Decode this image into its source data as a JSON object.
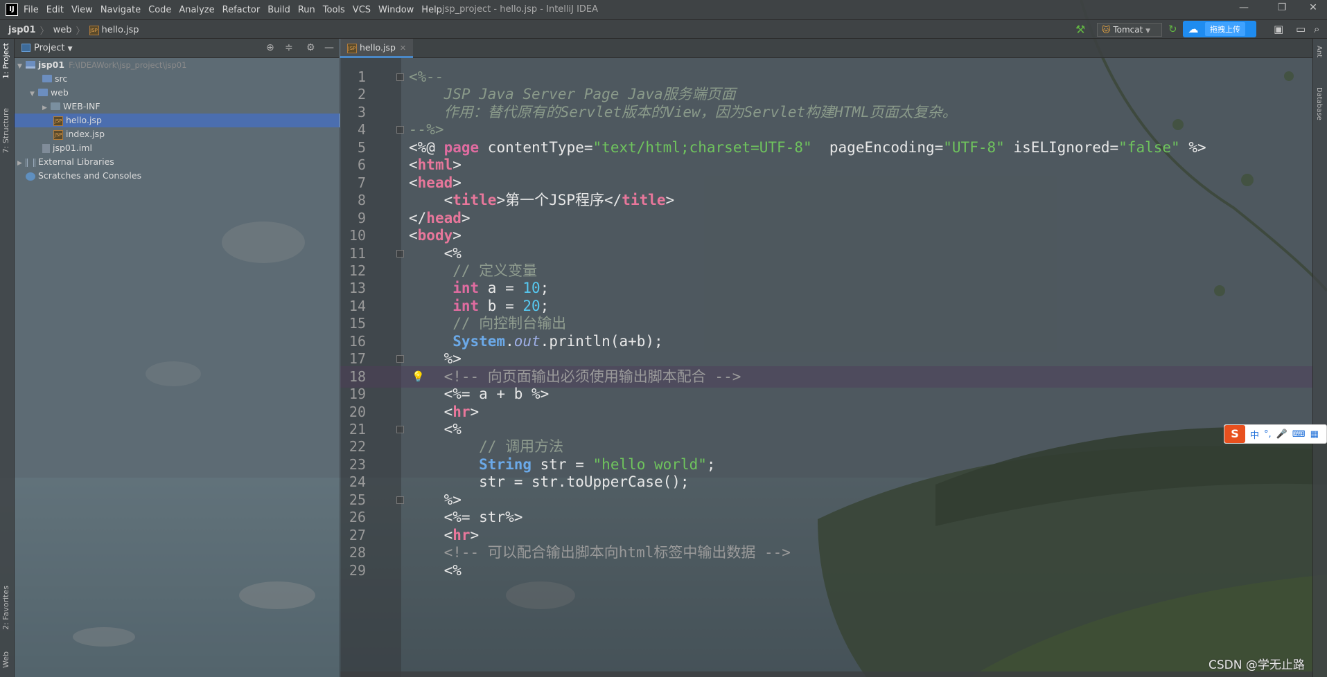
{
  "window": {
    "title": "jsp_project - hello.jsp - IntelliJ IDEA",
    "app_icon": "IJ"
  },
  "menu": [
    "File",
    "Edit",
    "View",
    "Navigate",
    "Code",
    "Analyze",
    "Refactor",
    "Build",
    "Run",
    "Tools",
    "VCS",
    "Window",
    "Help"
  ],
  "breadcrumb": {
    "root": "jsp01",
    "folder": "web",
    "file": "hello.jsp"
  },
  "toolbar": {
    "run_config": "Tomcat",
    "upload_label": "拖拽上传"
  },
  "left_strip": {
    "project_tab": "1: Project",
    "structure_tab": "7: Structure",
    "favorites_tab": "2: Favorites",
    "web_tab": "Web"
  },
  "right_strip": {
    "ant_tab": "Ant",
    "database_tab": "Database"
  },
  "project_panel": {
    "title": "Project",
    "tree": [
      {
        "label": "jsp01",
        "path": "F:\\IDEAWork\\jsp_project\\jsp01"
      },
      {
        "label": "src"
      },
      {
        "label": "web"
      },
      {
        "label": "WEB-INF"
      },
      {
        "label": "hello.jsp"
      },
      {
        "label": "index.jsp"
      },
      {
        "label": "jsp01.iml"
      },
      {
        "label": "External Libraries"
      },
      {
        "label": "Scratches and Consoles"
      }
    ]
  },
  "editor": {
    "tab_label": "hello.jsp",
    "current_line": 18,
    "lines": [
      {
        "n": "1",
        "seg": [
          [
            "cmt",
            "<%--"
          ]
        ]
      },
      {
        "n": "2",
        "seg": [
          [
            "cmt",
            "    JSP Java Server Page Java服务端页面"
          ]
        ]
      },
      {
        "n": "3",
        "seg": [
          [
            "cmt",
            "    作用：替代原有的Servlet版本的View，因为Servlet构建HTML页面太复杂。"
          ]
        ]
      },
      {
        "n": "4",
        "seg": [
          [
            "cmt",
            "--%>"
          ]
        ]
      },
      {
        "n": "5",
        "seg": [
          [
            "dir",
            "<%@ "
          ],
          [
            "kw",
            "page"
          ],
          [
            "attr",
            " contentType="
          ],
          [
            "str",
            "\"text/html;charset=UTF-8\""
          ],
          [
            "attr",
            "  pageEncoding="
          ],
          [
            "str",
            "\"UTF-8\""
          ],
          [
            "attr",
            " isELIgnored="
          ],
          [
            "str",
            "\"false\""
          ],
          [
            "dir",
            " %>"
          ]
        ]
      },
      {
        "n": "6",
        "seg": [
          [
            "tag",
            "<"
          ],
          [
            "name",
            "html"
          ],
          [
            "tag",
            ">"
          ]
        ]
      },
      {
        "n": "7",
        "seg": [
          [
            "tag",
            "<"
          ],
          [
            "name",
            "head"
          ],
          [
            "tag",
            ">"
          ]
        ]
      },
      {
        "n": "8",
        "seg": [
          [
            "tag",
            "    <"
          ],
          [
            "name",
            "title"
          ],
          [
            "tag",
            ">第一个JSP程序</"
          ],
          [
            "name",
            "title"
          ],
          [
            "tag",
            ">"
          ]
        ]
      },
      {
        "n": "9",
        "seg": [
          [
            "tag",
            "</"
          ],
          [
            "name",
            "head"
          ],
          [
            "tag",
            ">"
          ]
        ]
      },
      {
        "n": "10",
        "seg": [
          [
            "tag",
            "<"
          ],
          [
            "name",
            "body"
          ],
          [
            "tag",
            ">"
          ]
        ]
      },
      {
        "n": "11",
        "seg": [
          [
            "dir",
            "    <%"
          ]
        ]
      },
      {
        "n": "12",
        "seg": [
          [
            "lcmt",
            "     // 定义变量"
          ]
        ]
      },
      {
        "n": "13",
        "seg": [
          [
            "tag",
            "     "
          ],
          [
            "kw",
            "int"
          ],
          [
            "tag",
            " a = "
          ],
          [
            "num",
            "10"
          ],
          [
            "tag",
            ";"
          ]
        ]
      },
      {
        "n": "14",
        "seg": [
          [
            "tag",
            "     "
          ],
          [
            "kw",
            "int"
          ],
          [
            "tag",
            " b = "
          ],
          [
            "num",
            "20"
          ],
          [
            "tag",
            ";"
          ]
        ]
      },
      {
        "n": "15",
        "seg": [
          [
            "lcmt",
            "     // 向控制台输出"
          ]
        ]
      },
      {
        "n": "16",
        "seg": [
          [
            "tag",
            "     "
          ],
          [
            "cls",
            "System"
          ],
          [
            "tag",
            "."
          ],
          [
            "fld",
            "out"
          ],
          [
            "tag",
            ".println(a+b);"
          ]
        ]
      },
      {
        "n": "17",
        "seg": [
          [
            "dir",
            "    %>"
          ]
        ]
      },
      {
        "n": "18",
        "seg": [
          [
            "hcmt",
            "    <!-- 向页面输出必须使用输出脚本配合 -->"
          ]
        ]
      },
      {
        "n": "19",
        "seg": [
          [
            "dir",
            "    <%= a + b %>"
          ]
        ]
      },
      {
        "n": "20",
        "seg": [
          [
            "tag",
            "    <"
          ],
          [
            "name",
            "hr"
          ],
          [
            "tag",
            ">"
          ]
        ]
      },
      {
        "n": "21",
        "seg": [
          [
            "dir",
            "    <%"
          ]
        ]
      },
      {
        "n": "22",
        "seg": [
          [
            "lcmt",
            "        // 调用方法"
          ]
        ]
      },
      {
        "n": "23",
        "seg": [
          [
            "tag",
            "        "
          ],
          [
            "cls",
            "String"
          ],
          [
            "tag",
            " str = "
          ],
          [
            "str",
            "\"hello world\""
          ],
          [
            "tag",
            ";"
          ]
        ]
      },
      {
        "n": "24",
        "seg": [
          [
            "tag",
            "        str = str.toUpperCase();"
          ]
        ]
      },
      {
        "n": "25",
        "seg": [
          [
            "dir",
            "    %>"
          ]
        ]
      },
      {
        "n": "26",
        "seg": [
          [
            "dir",
            "    <%= str%>"
          ]
        ]
      },
      {
        "n": "27",
        "seg": [
          [
            "tag",
            "    <"
          ],
          [
            "name",
            "hr"
          ],
          [
            "tag",
            ">"
          ]
        ]
      },
      {
        "n": "28",
        "seg": [
          [
            "hcmt",
            "    <!-- 可以配合输出脚本向html标签中输出数据 -->"
          ]
        ]
      },
      {
        "n": "29",
        "seg": [
          [
            "dir",
            "    <%"
          ]
        ]
      }
    ]
  },
  "ime_bar": {
    "logo": "S",
    "items": [
      "中",
      "°,",
      "🎤",
      "⌨",
      "▦"
    ]
  },
  "watermark": "CSDN @学无止路",
  "colors": {
    "accent": "#4a88c7",
    "selection": "#4b6eaf",
    "tag": "#e8779b",
    "string": "#6fc45d",
    "number": "#56c8f0"
  }
}
